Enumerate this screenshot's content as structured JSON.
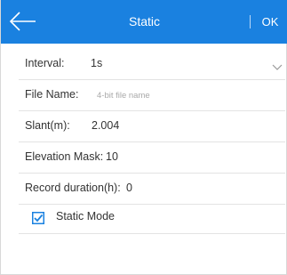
{
  "header": {
    "title": "Static",
    "ok_label": "OK",
    "back_icon": "back-arrow-icon"
  },
  "form": {
    "interval": {
      "label": "Interval:",
      "value": "1s",
      "icon": "chevron-down-icon"
    },
    "file_name": {
      "label": "File Name:",
      "value": "",
      "placeholder": "4-bit file name"
    },
    "slant": {
      "label": "Slant(m):",
      "value": "2.004"
    },
    "elevation_mask": {
      "label": "Elevation Mask:",
      "value": "10"
    },
    "record_duration": {
      "label": "Record duration(h):",
      "value": "0"
    },
    "static_mode": {
      "label": "Static Mode",
      "checked": true
    }
  },
  "colors": {
    "accent": "#1a81e0",
    "text": "#333333",
    "placeholder": "#a9a9a9",
    "divider": "#e3e3e3"
  }
}
